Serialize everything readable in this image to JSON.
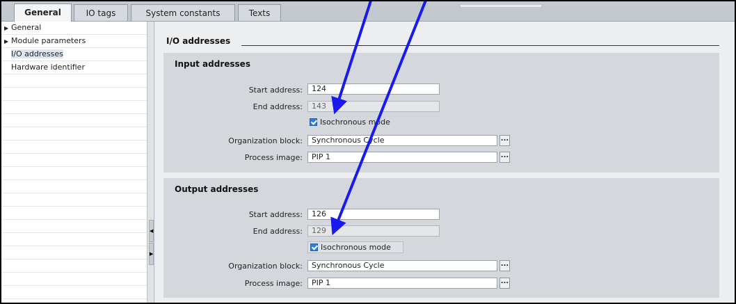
{
  "tabs": [
    {
      "label": "General",
      "active": true
    },
    {
      "label": "IO tags",
      "active": false
    },
    {
      "label": "System constants",
      "active": false
    },
    {
      "label": "Texts",
      "active": false
    }
  ],
  "nav": [
    {
      "label": "General",
      "expandable": true
    },
    {
      "label": "Module parameters",
      "expandable": true
    },
    {
      "label": "I/O addresses",
      "expandable": false,
      "selected": true
    },
    {
      "label": "Hardware identifier",
      "expandable": false
    }
  ],
  "section_title": "I/O addresses",
  "input": {
    "title": "Input addresses",
    "start_label": "Start address:",
    "start_value": "124",
    "end_label": "End address:",
    "end_value": "143",
    "iso_label": "Isochronous mode",
    "iso_checked": true,
    "ob_label": "Organization block:",
    "ob_value": "Synchronous Cycle",
    "pi_label": "Process image:",
    "pi_value": "PIP 1",
    "browse": "..."
  },
  "output": {
    "title": "Output addresses",
    "start_label": "Start address:",
    "start_value": "126",
    "end_label": "End address:",
    "end_value": "129",
    "iso_label": "Isochronous mode",
    "iso_checked": true,
    "ob_label": "Organization block:",
    "ob_value": "Synchronous Cycle",
    "pi_label": "Process image:",
    "pi_value": "PIP 1",
    "browse": "..."
  },
  "colors": {
    "annotation_arrow": "#1a1aee",
    "checkbox": "#2f7fd8"
  }
}
